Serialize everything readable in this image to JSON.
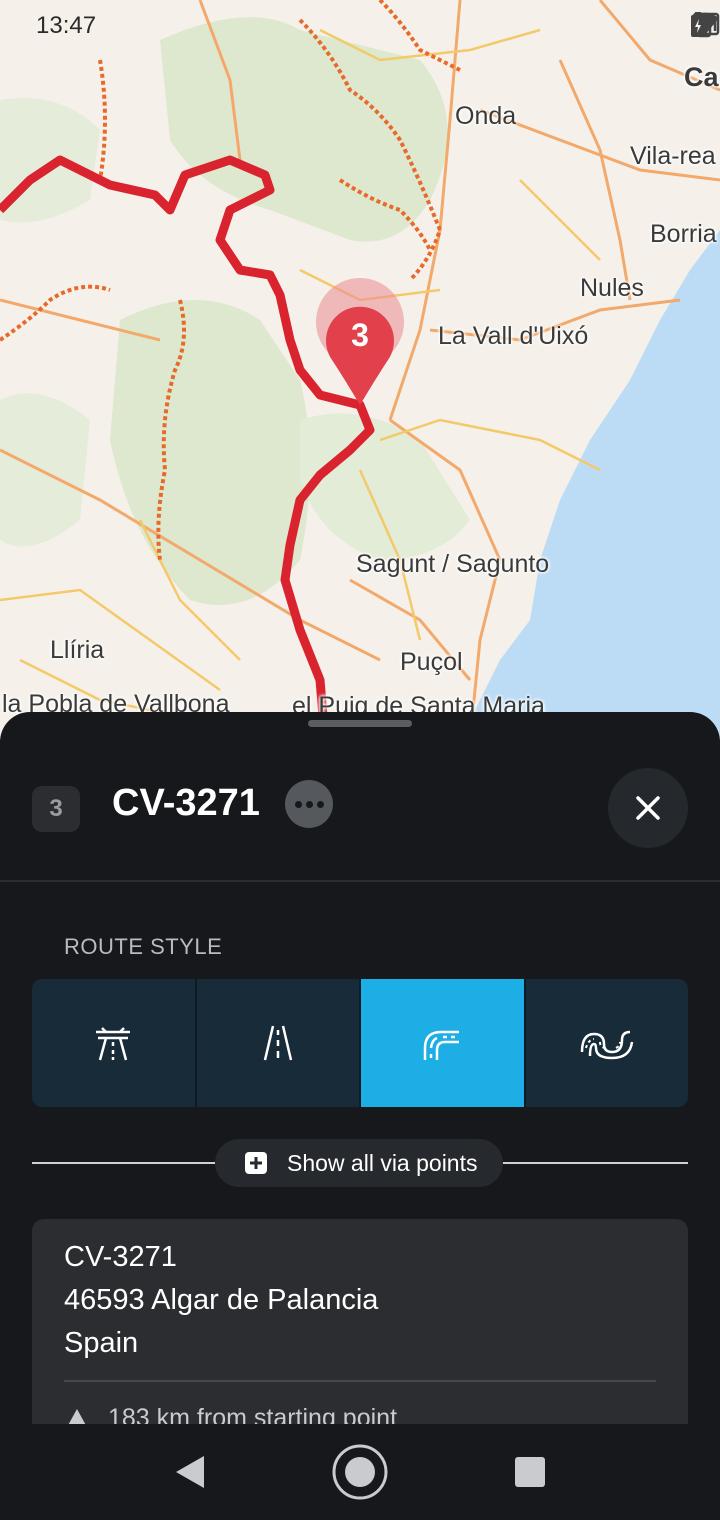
{
  "status_bar": {
    "time": "13:47"
  },
  "map": {
    "labels": [
      "Onda",
      "Vila-rea",
      "Borria",
      "Nules",
      "La Vall d'Uixó",
      "Sagunt / Sagunto",
      "Llíria",
      "Puçol",
      "la Pobla de Vallbona",
      "el Puig de Santa Maria",
      "Ca"
    ],
    "marker_number": "3",
    "route_color": "#d9232e"
  },
  "sheet": {
    "badge": "3",
    "title": "CV-3271",
    "section_label": "ROUTE STYLE",
    "route_styles": [
      {
        "name": "highway",
        "icon": "highway-icon",
        "active": false
      },
      {
        "name": "road",
        "icon": "road-icon",
        "active": false
      },
      {
        "name": "curvy",
        "icon": "curvy-road-icon",
        "active": true
      },
      {
        "name": "extra-curvy",
        "icon": "winding-road-icon",
        "active": false
      }
    ],
    "active_color": "#1eaee6",
    "via_points_label": "Show all via points",
    "address": {
      "line1": "CV-3271",
      "line2": "46593 Algar de Palancia",
      "line3": "Spain",
      "distance": "183 km from starting point"
    }
  }
}
